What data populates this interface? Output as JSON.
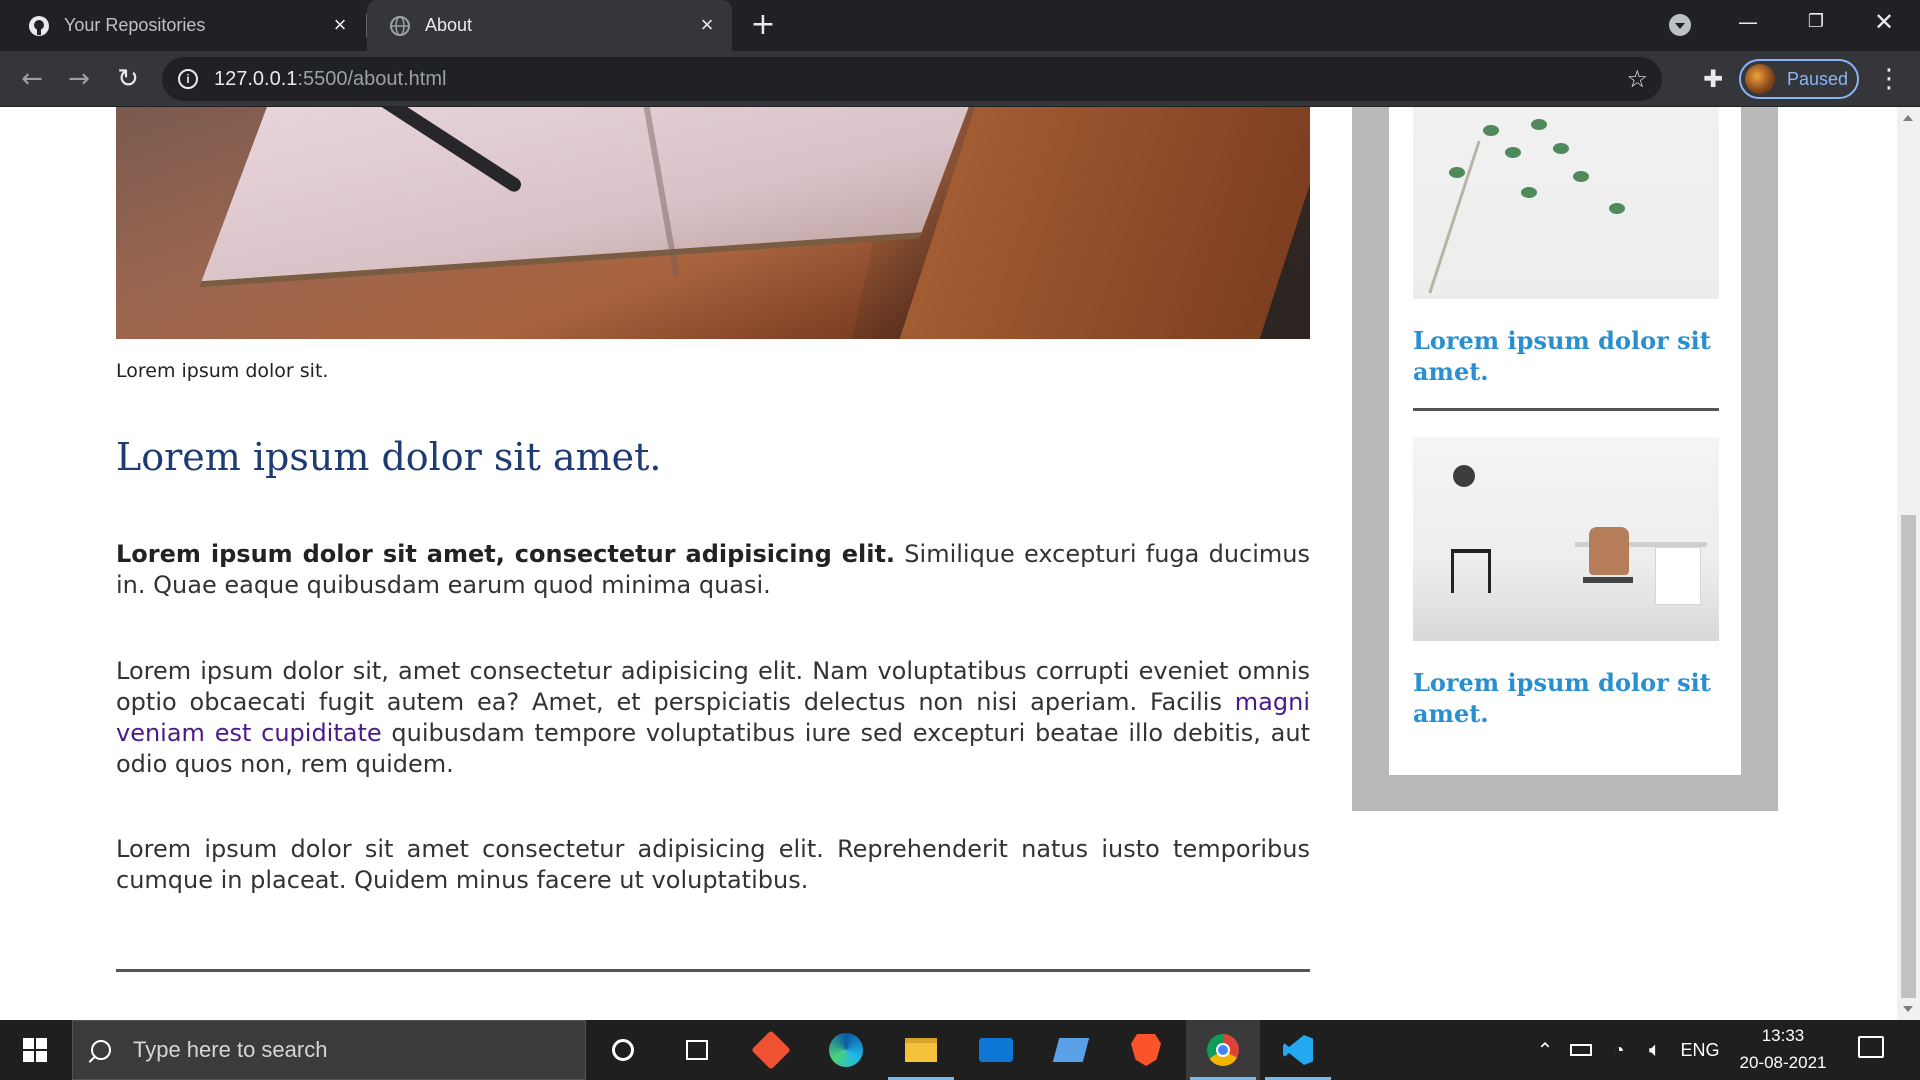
{
  "browser": {
    "tabs": [
      {
        "label": "Your Repositories",
        "icon": "github-icon",
        "active": false
      },
      {
        "label": "About",
        "icon": "globe-icon",
        "active": true
      }
    ],
    "address": {
      "host": "127.0.0.1",
      "rest": ":5500/about.html"
    },
    "profile_status": "Paused",
    "accent": "#8ab4f8"
  },
  "page": {
    "caption": "Lorem ipsum dolor sit.",
    "title": "Lorem ipsum dolor sit amet.",
    "para1": {
      "bold": "Lorem ipsum dolor sit amet, consectetur adipisicing elit.",
      "rest": " Similique excepturi fuga ducimus in. Quae eaque quibusdam earum quod minima quasi."
    },
    "para2": {
      "before": "Lorem ipsum dolor sit, amet consectetur adipisicing elit. Nam voluptatibus corrupti eveniet omnis optio obcaecati fugit autem ea? Amet, et perspiciatis delectus non nisi aperiam. Facilis ",
      "link": "magni veniam est cupiditate",
      "after": " quibusdam tempore voluptatibus iure sed excepturi beatae illo debitis, aut odio quos non, rem quidem."
    },
    "para3": "Lorem ipsum dolor sit amet consectetur adipisicing elit. Reprehenderit natus iusto temporibus cumque in placeat. Quidem minus facere ut voluptatibus.",
    "title_color": "#1f3b73",
    "link_color": "#4b1a8a"
  },
  "sidebar": {
    "items": [
      {
        "title": "Lorem ipsum dolor sit amet."
      },
      {
        "title": "Lorem ipsum dolor sit amet."
      }
    ],
    "link_color": "#2a8fd0"
  },
  "taskbar": {
    "search_placeholder": "Type here to search",
    "apps": [
      "cortana-icon",
      "task-view-icon",
      "git-icon",
      "edge-icon",
      "file-explorer-icon",
      "mail-icon",
      "app-icon",
      "brave-icon",
      "chrome-icon",
      "vscode-icon"
    ],
    "language": "ENG",
    "time": "13:33",
    "date": "20-08-2021"
  }
}
